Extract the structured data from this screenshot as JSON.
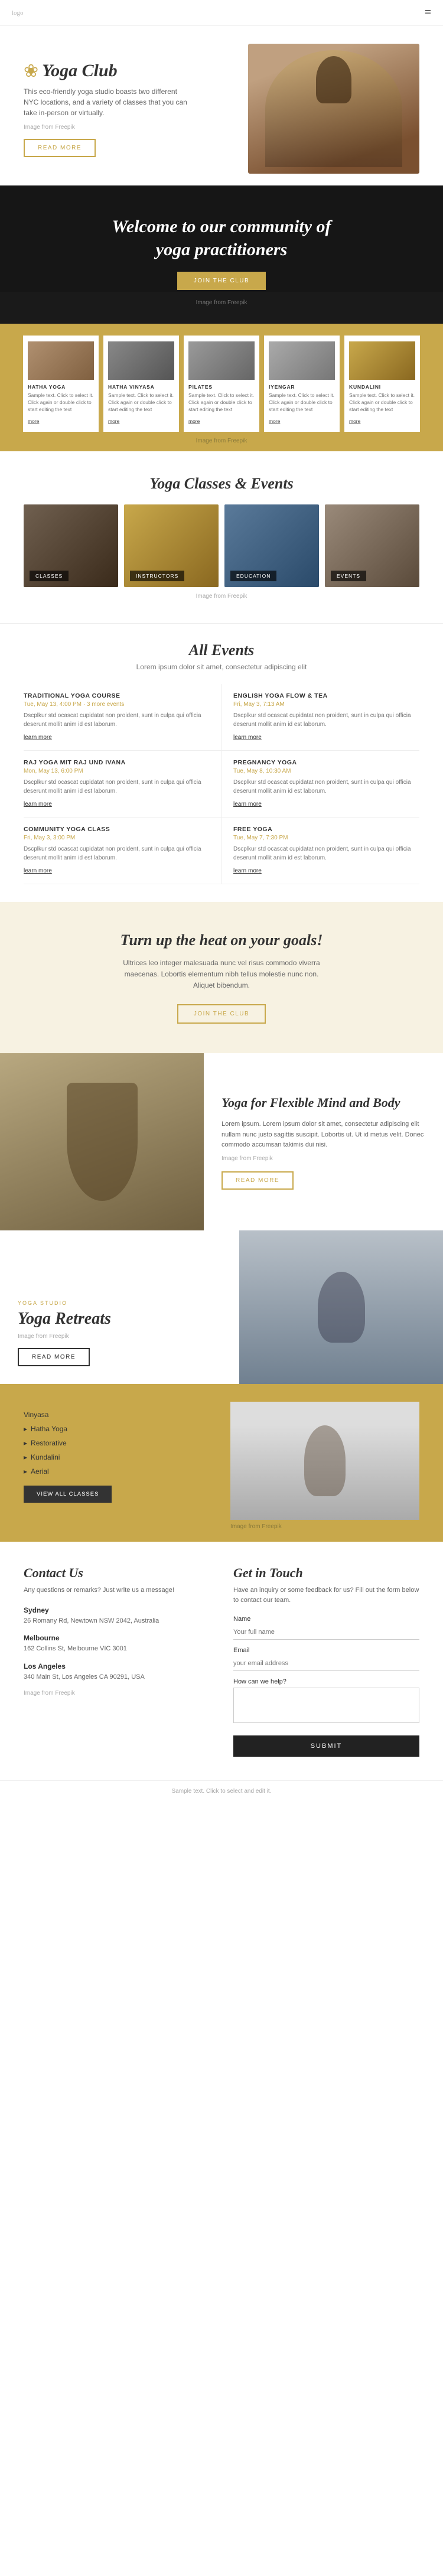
{
  "nav": {
    "logo": "logo",
    "hamburger": "≡"
  },
  "hero": {
    "brand_icon": "❀",
    "brand_name": "Yoga Club",
    "description": "This eco-friendly yoga studio boasts two different NYC locations, and a variety of classes that you can take in-person or virtually.",
    "img_credit_pre": "Image from",
    "img_credit_link": "Freepik",
    "read_more": "READ MORE"
  },
  "welcome": {
    "heading": "Welcome to our community of",
    "heading2": "yoga practitioners",
    "cta": "JOIN THE CLUB",
    "img_credit_pre": "Image from",
    "img_credit_link": "Freepik"
  },
  "yoga_types": [
    {
      "title": "HATHA YOGA",
      "desc": "Sample text. Click to select it. Click again or double click to start editing the text",
      "more": "more"
    },
    {
      "title": "HATHA VINYASA",
      "desc": "Sample text. Click to select it. Click again or double click to start editing the text",
      "more": "more"
    },
    {
      "title": "PILATES",
      "desc": "Sample text. Click to select it. Click again or double click to start editing the text",
      "more": "more"
    },
    {
      "title": "IYENGAR",
      "desc": "Sample text. Click to select it. Click again or double click to start editing the text",
      "more": "more"
    },
    {
      "title": "KUNDALINI",
      "desc": "Sample text. Click to select it. Click again or double click to start editing the text",
      "more": "more"
    }
  ],
  "types_img_credit_pre": "Image from",
  "types_img_credit_link": "Freepik",
  "classes_events": {
    "heading": "Yoga Classes & Events",
    "cards": [
      {
        "label": "CLASSES"
      },
      {
        "label": "INSTRUCTORS"
      },
      {
        "label": "EDUCATION"
      },
      {
        "label": "EVENTS"
      }
    ],
    "img_credit_pre": "Image from",
    "img_credit_link": "Freepik"
  },
  "all_events": {
    "heading": "All Events",
    "subtitle": "Lorem ipsum dolor sit amet, consectetur adipiscing elit",
    "events": [
      {
        "title": "TRADITIONAL YOGA COURSE",
        "date": "Tue, May 13, 4:00 PM · 3 more events",
        "desc": "Dscplkur std ocascat cupidatat non proident, sunt in culpa qui officia deserunt mollit anim id est laborum.",
        "link": "learn more"
      },
      {
        "title": "ENGLISH YOGA FLOW & TEA",
        "date": "Fri, May 3, 7:13 AM",
        "desc": "Dscplkur std ocascat cupidatat non proident, sunt in culpa qui officia deserunt mollit anim id est laborum.",
        "link": "learn more"
      },
      {
        "title": "RAJ YOGA MIT RAJ UND IVANA",
        "date": "Mon, May 13, 6:00 PM",
        "desc": "Dscplkur std ocascat cupidatat non proident, sunt in culpa qui officia deserunt mollit anim id est laborum.",
        "link": "learn more"
      },
      {
        "title": "PREGNANCY YOGA",
        "date": "Tue, May 8, 10:30 AM",
        "desc": "Dscplkur std ocascat cupidatat non proident, sunt in culpa qui officia deserunt mollit anim id est laborum.",
        "link": "learn more"
      },
      {
        "title": "COMMUNITY YOGA CLASS",
        "date": "Fri, May 3, 3:00 PM",
        "desc": "Dscplkur std ocascat cupidatat non proident, sunt in culpa qui officia deserunt mollit anim id est laborum.",
        "link": "learn more"
      },
      {
        "title": "FREE YOGA",
        "date": "Tue, May 7, 7:30 PM",
        "desc": "Dscplkur std ocascat cupidatat non proident, sunt in culpa qui officia deserunt mollit anim id est laborum.",
        "link": "learn more"
      }
    ]
  },
  "heat_banner": {
    "heading": "Turn up the heat on your goals!",
    "desc": "Ultrices leo integer malesuada nunc vel risus commodo viverra maecenas. Lobortis elementum nibh tellus molestie nunc non. Aliquet bibendum.",
    "cta": "JOIN THE CLUB"
  },
  "flex_section": {
    "heading": "Yoga for Flexible Mind and Body",
    "desc": "Lorem ipsum. Lorem ipsum dolor sit amet, consectetur adipiscing elit nullam nunc justo sagittis suscipit. Lobortis ut. Ut id metus velit. Donec commodo accumsan takimis dui nisi.",
    "img_credit_pre": "Image from",
    "img_credit_link": "Freepik",
    "read_more": "READ MORE"
  },
  "retreats": {
    "studio_label": "YOGA STUDIO",
    "heading": "Yoga Retreats",
    "img_credit_pre": "Image from",
    "img_credit_link": "Freepik",
    "read_more": "READ MORE"
  },
  "classes_list": {
    "items": [
      "Vinyasa",
      "Hatha Yoga",
      "Restorative",
      "Kundalini",
      "Aerial"
    ],
    "img_credit_pre": "Image from",
    "img_credit_link": "Freepik",
    "view_all": "VIEW ALL CLASSES"
  },
  "contact": {
    "heading": "Contact Us",
    "intro": "Any questions or remarks? Just write us a message!",
    "cities": [
      {
        "name": "Sydney",
        "address": "26 Romany Rd, Newtown NSW 2042, Australia"
      },
      {
        "name": "Melbourne",
        "address": "162 Collins St, Melbourne VIC 3001"
      },
      {
        "name": "Los Angeles",
        "address": "340 Main St, Los Angeles CA 90291, USA"
      }
    ],
    "img_credit_pre": "Image from",
    "img_credit_link": "Freepik"
  },
  "get_in_touch": {
    "heading": "Get in Touch",
    "intro": "Have an inquiry or some feedback for us? Fill out the form below to contact our team.",
    "fields": {
      "name_label": "Name",
      "name_placeholder": "Your full name",
      "email_label": "Email",
      "email_placeholder": "your email address",
      "message_label": "How can we help?",
      "message_placeholder": ""
    },
    "submit": "SUBMIT"
  },
  "footer": {
    "text": "Sample text. Click to select and edit it."
  }
}
